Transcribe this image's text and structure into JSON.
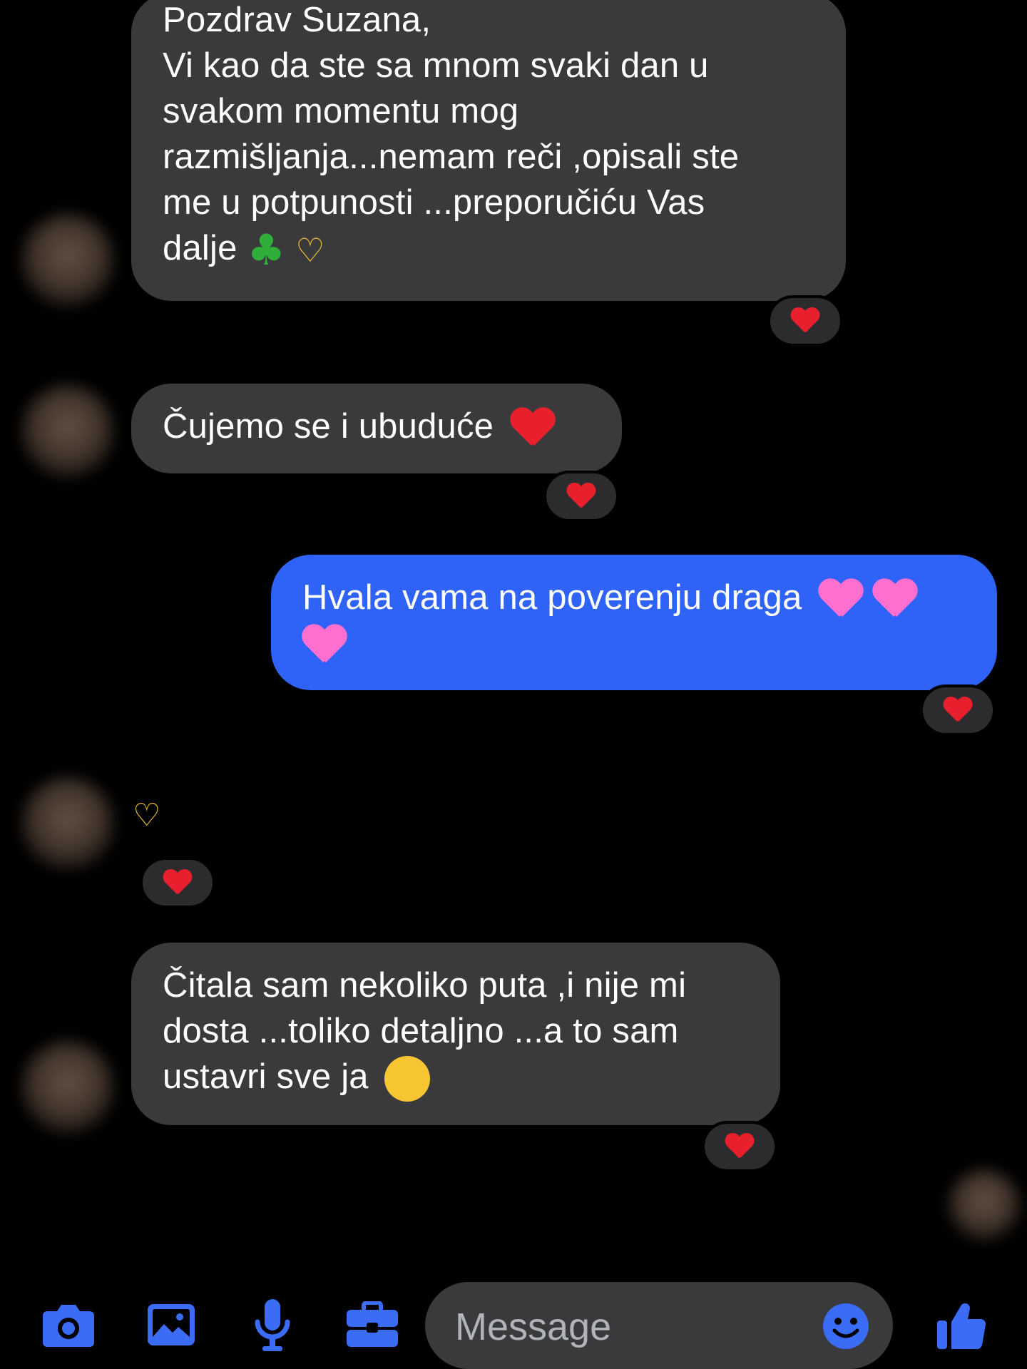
{
  "conversation": {
    "messages": [
      {
        "direction": "incoming",
        "lines": [
          "Pozdrav Suzana,",
          "Vi kao da ste sa mnom svaki dan u",
          "svakom momentu mog",
          "razmišljanja...nemam reči ,opisali ste",
          "me u potpunosti ...preporučiću Vas",
          "dalje"
        ],
        "emojis": [
          "four-leaf-clover",
          "heart-hands"
        ],
        "reaction": "red-heart"
      },
      {
        "direction": "incoming",
        "lines": [
          "Čujemo se i ubuduće"
        ],
        "emojis": [
          "red-heart"
        ],
        "reaction": "red-heart"
      },
      {
        "direction": "outgoing",
        "lines": [
          "Hvala vama na poverenju draga"
        ],
        "emojis": [
          "pink-heart",
          "pink-heart",
          "pink-heart"
        ],
        "reaction": "red-heart"
      },
      {
        "direction": "incoming",
        "lines": [],
        "emojis": [
          "heart-hands"
        ],
        "reaction": "red-heart"
      },
      {
        "direction": "incoming",
        "lines": [
          "Čitala sam nekoliko puta ,i nije mi",
          "dosta ...toliko detaljno ...a to sam",
          "ustavri sve ja"
        ],
        "emojis": [
          "hugging-face"
        ],
        "reaction": "red-heart"
      }
    ]
  },
  "composer": {
    "placeholder": "Message",
    "icons": [
      "camera-icon",
      "gallery-icon",
      "microphone-icon",
      "briefcase-icon",
      "emoji-icon",
      "thumbs-up-icon"
    ]
  },
  "colors": {
    "background": "#000000",
    "incoming_bubble": "#3a3a3c",
    "outgoing_bubble": "#2f62f6",
    "accent": "#3b6cf6",
    "red_heart": "#e8202e",
    "pink_heart": "#ff6fd0"
  }
}
